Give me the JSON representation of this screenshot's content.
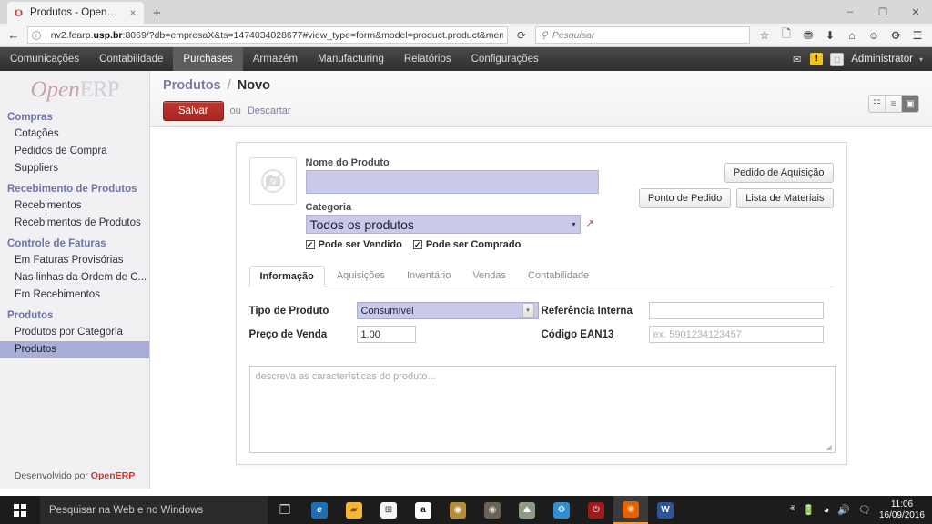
{
  "browser": {
    "tab": {
      "title": "Produtos - OpenERP",
      "favicon": "opera-o-icon",
      "close": "×"
    },
    "newtab_label": "+",
    "window_controls": {
      "minimize": "–",
      "restore": "❐",
      "close": "✕"
    },
    "nav": {
      "back": "←",
      "forward": "→",
      "reload": "⟳"
    },
    "url": {
      "host_prefix": "nv2.fearp.",
      "host_bold": "usp.br",
      "rest": ":8069/?db=empresaX&ts=1474034028677#view_type=form&model=product.product&menu_i",
      "info_icon": "ⓘ"
    },
    "search": {
      "placeholder": "Pesquisar",
      "icon": "🔍"
    },
    "toolbar_icons": [
      "star-icon",
      "reading-list-icon",
      "pocket-icon",
      "downloads-icon",
      "home-icon",
      "account-icon",
      "sync-icon",
      "menu-icon"
    ]
  },
  "oe_menu": {
    "items": [
      {
        "label": "Comunicações",
        "active": false
      },
      {
        "label": "Contabilidade",
        "active": false
      },
      {
        "label": "Purchases",
        "active": true
      },
      {
        "label": "Armazém",
        "active": false
      },
      {
        "label": "Manufacturing",
        "active": false
      },
      {
        "label": "Relatórios",
        "active": false
      },
      {
        "label": "Configurações",
        "active": false
      }
    ],
    "mail_icon": "✉",
    "warning_icon": "⚠",
    "user": "Administrator",
    "caret": "▾"
  },
  "sidebar": {
    "logo": {
      "part1": "Open",
      "part2": "ERP"
    },
    "groups": [
      {
        "title": "Compras",
        "items": [
          {
            "label": "Cotações",
            "selected": false
          },
          {
            "label": "Pedidos de Compra",
            "selected": false
          },
          {
            "label": "Suppliers",
            "selected": false
          }
        ]
      },
      {
        "title": "Recebimento de Produtos",
        "items": [
          {
            "label": "Recebimentos",
            "selected": false
          },
          {
            "label": "Recebimentos de Produtos",
            "selected": false
          }
        ]
      },
      {
        "title": "Controle de Faturas",
        "items": [
          {
            "label": "Em Faturas Provisórias",
            "selected": false
          },
          {
            "label": "Nas linhas da Ordem de C...",
            "selected": false
          },
          {
            "label": "Em Recebimentos",
            "selected": false
          }
        ]
      },
      {
        "title": "Produtos",
        "items": [
          {
            "label": "Produtos por Categoria",
            "selected": false
          },
          {
            "label": "Produtos",
            "selected": true
          }
        ]
      }
    ],
    "footer": {
      "text": "Desenvolvido por ",
      "brand": "OpenERP"
    }
  },
  "page": {
    "breadcrumb": {
      "parent": "Produtos",
      "sep": "/",
      "current": "Novo"
    },
    "save_label": "Salvar",
    "or_label": "ou",
    "discard_label": "Descartar",
    "view_switch": [
      {
        "name": "kanban-view-icon",
        "glyph": "☷",
        "active": false
      },
      {
        "name": "list-view-icon",
        "glyph": "≡",
        "active": false
      },
      {
        "name": "form-view-icon",
        "glyph": "▣",
        "active": true
      }
    ]
  },
  "form": {
    "image_placeholder_icon": "no-camera-icon",
    "product_name": {
      "label": "Nome do Produto",
      "value": ""
    },
    "category": {
      "label": "Categoria",
      "value": "Todos os produtos",
      "arrow": "▾",
      "external_link_icon": "↗"
    },
    "checkboxes": [
      {
        "label": "Pode ser Vendido",
        "checked": true,
        "mark": "✓"
      },
      {
        "label": "Pode ser Comprado",
        "checked": true,
        "mark": "✓"
      }
    ],
    "header_buttons": [
      {
        "label": "Pedido de Aquisição"
      },
      {
        "label": "Ponto de Pedido"
      },
      {
        "label": "Lista de Materiais"
      }
    ],
    "tabs": [
      {
        "label": "Informação",
        "active": true
      },
      {
        "label": "Aquisições",
        "active": false
      },
      {
        "label": "Inventário",
        "active": false
      },
      {
        "label": "Vendas",
        "active": false
      },
      {
        "label": "Contabilidade",
        "active": false
      }
    ],
    "fields": {
      "product_type": {
        "label": "Tipo de Produto",
        "value": "Consumível",
        "arrow": "▾"
      },
      "sale_price": {
        "label": "Preço de Venda",
        "value": "1.00"
      },
      "internal_ref": {
        "label": "Referência Interna",
        "value": ""
      },
      "ean13": {
        "label": "Código EAN13",
        "value": "",
        "placeholder": "ex. 5901234123457"
      }
    },
    "description": {
      "placeholder": "descreva as características do produto..."
    }
  },
  "taskbar": {
    "start_icon": "windows-logo-icon",
    "search_placeholder": "Pesquisar na Web e no Windows",
    "taskview_icon": "❐",
    "apps": [
      {
        "name": "edge-icon",
        "glyph": "e",
        "color": "#1f6fb5",
        "text": "#ffffff",
        "active": false
      },
      {
        "name": "file-explorer-icon",
        "glyph": "▰",
        "color": "#f5b731",
        "text": "#7a5200",
        "active": false
      },
      {
        "name": "store-icon",
        "glyph": "⊞",
        "color": "#f4f4f4",
        "text": "#333333",
        "active": false
      },
      {
        "name": "amazon-icon",
        "glyph": "a",
        "color": "#ffffff",
        "text": "#111111",
        "active": false
      },
      {
        "name": "gold-app-icon",
        "glyph": "◉",
        "color": "#b58c3a",
        "text": "#ffffff",
        "active": false
      },
      {
        "name": "dark-app-icon",
        "glyph": "◉",
        "color": "#6b6257",
        "text": "#e4dcd0",
        "active": false
      },
      {
        "name": "photos-app-icon",
        "glyph": "⛰",
        "color": "#8e9c86",
        "text": "#ffffff",
        "active": false
      },
      {
        "name": "blue-app-icon",
        "glyph": "⚙",
        "color": "#2e8fd0",
        "text": "#ffffff",
        "active": false
      },
      {
        "name": "power-app-icon",
        "glyph": "⏻",
        "color": "#9d1b1b",
        "text": "#ffffff",
        "active": false
      },
      {
        "name": "firefox-icon",
        "glyph": "◉",
        "color": "#e66000",
        "text": "#ffd18c",
        "active": true
      },
      {
        "name": "word-icon",
        "glyph": "W",
        "color": "#2b579a",
        "text": "#ffffff",
        "active": false
      }
    ],
    "tray": {
      "chevron": "ⱏ",
      "battery": "▬",
      "wifi": "◠",
      "volume": "◂",
      "notify": "▢"
    },
    "clock": {
      "time": "11:06",
      "date": "16/09/2016"
    }
  }
}
